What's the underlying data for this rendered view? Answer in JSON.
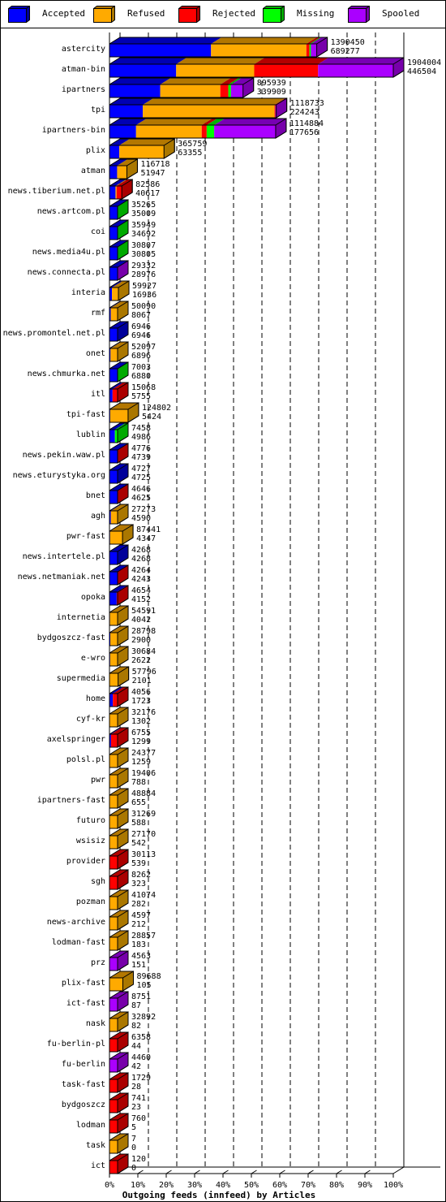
{
  "chart_data": {
    "type": "bar",
    "orientation": "horizontal",
    "stacked": true,
    "title": "Outgoing feeds (innfeed) by Articles",
    "xlabel": "Outgoing feeds (innfeed) by Articles",
    "ylabel": "",
    "xlim": [
      0,
      100
    ],
    "x_ticks": [
      "0%",
      "10%",
      "20%",
      "30%",
      "40%",
      "50%",
      "60%",
      "70%",
      "80%",
      "90%",
      "100%"
    ],
    "grid": true,
    "legend_position": "top",
    "legend": [
      {
        "name": "Accepted",
        "color": "#0000ff",
        "side": "#00009a"
      },
      {
        "name": "Refused",
        "color": "#ffaa00",
        "side": "#aa7700"
      },
      {
        "name": "Rejected",
        "color": "#ff0000",
        "side": "#aa0000"
      },
      {
        "name": "Missing",
        "color": "#00ff00",
        "side": "#00aa00"
      },
      {
        "name": "Spooled",
        "color": "#aa00ff",
        "side": "#7700aa"
      }
    ],
    "max_total": 1904004,
    "categories": [
      "astercity",
      "atman-bin",
      "ipartners",
      "tpi",
      "ipartners-bin",
      "plix",
      "atman",
      "news.tiberium.net.pl",
      "news.artcom.pl",
      "coi",
      "news.media4u.pl",
      "news.connecta.pl",
      "interia",
      "rmf",
      "news.promontel.net.pl",
      "onet",
      "news.chmurka.net",
      "itl",
      "tpi-fast",
      "lublin",
      "news.pekin.waw.pl",
      "news.eturystyka.org",
      "bnet",
      "agh",
      "pwr-fast",
      "news.intertele.pl",
      "news.netmaniak.net",
      "opoka",
      "internetia",
      "bydgoszcz-fast",
      "e-wro",
      "supermedia",
      "home",
      "cyf-kr",
      "axelspringer",
      "polsl.pl",
      "pwr",
      "ipartners-fast",
      "futuro",
      "wsisiz",
      "provider",
      "sgh",
      "pozman",
      "news-archive",
      "lodman-fast",
      "prz",
      "plix-fast",
      "ict-fast",
      "nask",
      "fu-berlin-pl",
      "fu-berlin",
      "task-fast",
      "bydgoszcz",
      "lodman",
      "task",
      "ict"
    ],
    "totals": [
      1390450,
      1904004,
      895939,
      1118733,
      1114884,
      365759,
      116718,
      82586,
      35265,
      35949,
      30807,
      29332,
      59927,
      50090,
      6946,
      52097,
      7003,
      15068,
      124802,
      7458,
      4776,
      4727,
      4646,
      27273,
      87441,
      4268,
      4264,
      4654,
      54591,
      28798,
      30684,
      57796,
      4056,
      32176,
      6755,
      24377,
      19406,
      48884,
      31269,
      27170,
      30113,
      8262,
      41074,
      4597,
      28857,
      4563,
      89688,
      8751,
      32892,
      6358,
      4460,
      1729,
      741,
      760,
      7,
      120
    ],
    "accepted": [
      689277,
      446504,
      339909,
      224243,
      177656,
      63355,
      51947,
      40617,
      35009,
      34692,
      30805,
      28976,
      16936,
      8067,
      6946,
      6896,
      6880,
      5755,
      5424,
      4986,
      4739,
      4725,
      4625,
      4590,
      4347,
      4268,
      4243,
      4152,
      4042,
      2900,
      2622,
      2101,
      1723,
      1302,
      1299,
      1259,
      788,
      655,
      588,
      542,
      539,
      323,
      282,
      212,
      183,
      151,
      105,
      87,
      82,
      44,
      42,
      28,
      23,
      5,
      0,
      0
    ],
    "segments": [
      [
        0.49,
        0.46,
        0.015,
        0.007,
        0.028
      ],
      [
        0.235,
        0.275,
        0.225,
        0.0,
        0.265
      ],
      [
        0.38,
        0.45,
        0.06,
        0.02,
        0.09
      ],
      [
        0.2,
        0.79,
        0.005,
        0.0,
        0.005
      ],
      [
        0.16,
        0.395,
        0.03,
        0.045,
        0.37
      ],
      [
        0.18,
        0.82,
        0.0,
        0.0,
        0.0
      ],
      [
        0.44,
        0.56,
        0.0,
        0.0,
        0.0
      ],
      [
        0.49,
        0.09,
        0.42,
        0.0,
        0.0
      ],
      [
        0.99,
        0.0,
        0.0,
        0.01,
        0.0
      ],
      [
        0.965,
        0.0,
        0.0,
        0.035,
        0.0
      ],
      [
        0.99,
        0.0,
        0.0,
        0.01,
        0.0
      ],
      [
        0.99,
        0.0,
        0.0,
        0.0,
        0.01
      ],
      [
        0.28,
        0.72,
        0.0,
        0.0,
        0.0
      ],
      [
        0.16,
        0.84,
        0.0,
        0.0,
        0.0
      ],
      [
        1.0,
        0.0,
        0.0,
        0.0,
        0.0
      ],
      [
        0.13,
        0.87,
        0.0,
        0.0,
        0.0
      ],
      [
        0.98,
        0.0,
        0.0,
        0.02,
        0.0
      ],
      [
        0.38,
        0.0,
        0.62,
        0.0,
        0.0
      ],
      [
        0.04,
        0.96,
        0.0,
        0.0,
        0.0
      ],
      [
        0.67,
        0.0,
        0.0,
        0.33,
        0.0
      ],
      [
        0.99,
        0.0,
        0.01,
        0.0,
        0.0
      ],
      [
        1.0,
        0.0,
        0.0,
        0.0,
        0.0
      ],
      [
        0.99,
        0.0,
        0.01,
        0.0,
        0.0
      ],
      [
        0.17,
        0.83,
        0.0,
        0.0,
        0.0
      ],
      [
        0.05,
        0.95,
        0.0,
        0.0,
        0.0
      ],
      [
        1.0,
        0.0,
        0.0,
        0.0,
        0.0
      ],
      [
        0.99,
        0.0,
        0.01,
        0.0,
        0.0
      ],
      [
        0.89,
        0.0,
        0.11,
        0.0,
        0.0
      ],
      [
        0.07,
        0.93,
        0.0,
        0.0,
        0.0
      ],
      [
        0.1,
        0.9,
        0.0,
        0.0,
        0.0
      ],
      [
        0.085,
        0.915,
        0.0,
        0.0,
        0.0
      ],
      [
        0.04,
        0.96,
        0.0,
        0.0,
        0.0
      ],
      [
        0.42,
        0.0,
        0.58,
        0.0,
        0.0
      ],
      [
        0.04,
        0.96,
        0.0,
        0.0,
        0.0
      ],
      [
        0.19,
        0.0,
        0.81,
        0.0,
        0.0
      ],
      [
        0.05,
        0.95,
        0.0,
        0.0,
        0.0
      ],
      [
        0.04,
        0.96,
        0.0,
        0.0,
        0.0
      ],
      [
        0.013,
        0.987,
        0.0,
        0.0,
        0.0
      ],
      [
        0.02,
        0.98,
        0.0,
        0.0,
        0.0
      ],
      [
        0.02,
        0.98,
        0.0,
        0.0,
        0.0
      ],
      [
        0.018,
        0.0,
        0.982,
        0.0,
        0.0
      ],
      [
        0.04,
        0.0,
        0.96,
        0.0,
        0.0
      ],
      [
        0.007,
        0.993,
        0.0,
        0.0,
        0.0
      ],
      [
        0.046,
        0.954,
        0.0,
        0.0,
        0.0
      ],
      [
        0.006,
        0.994,
        0.0,
        0.0,
        0.0
      ],
      [
        0.033,
        0.0,
        0.0,
        0.0,
        0.967
      ],
      [
        0.001,
        0.999,
        0.0,
        0.0,
        0.0
      ],
      [
        0.01,
        0.0,
        0.0,
        0.0,
        0.99
      ],
      [
        0.002,
        0.998,
        0.0,
        0.0,
        0.0
      ],
      [
        0.007,
        0.0,
        0.993,
        0.0,
        0.0
      ],
      [
        0.01,
        0.0,
        0.0,
        0.0,
        0.99
      ],
      [
        0.016,
        0.0,
        0.984,
        0.0,
        0.0
      ],
      [
        0.03,
        0.0,
        0.97,
        0.0,
        0.0
      ],
      [
        0.007,
        0.0,
        0.993,
        0.0,
        0.0
      ],
      [
        0.0,
        1.0,
        0.0,
        0.0,
        0.0
      ],
      [
        0.0,
        0.0,
        1.0,
        0.0,
        0.0
      ]
    ],
    "front_colors": [
      "mixed",
      "mixed",
      "mixed",
      "mixed",
      "mixed",
      "mixed",
      "mixed",
      "mixed",
      "#0000ff|#00aa00",
      "#0000ff|#00aa00",
      "#0000ff|#00aa00",
      "#0000ff|#7700aa",
      "#ffaa00|#7700aa",
      "#ffaa00|#7700aa",
      "#00009a",
      "#ffaa00|#00aa00",
      "#00aa00",
      "#aa0000",
      "#ffaa00|#7700aa",
      "#00aa00",
      "#aa0000",
      "#aa0000",
      "#aa0000",
      "#ffaa00|#aa0000",
      "#ffaa00|#7700aa",
      "#00009a",
      "#aa0000",
      "#aa0000",
      "#ffaa00|#7700aa",
      "#ffaa00|#7700aa",
      "#ffaa00|#aa7700",
      "#ffaa00|#7700aa",
      "#aa0000",
      "#ffaa00|#00aa00",
      "#aa0000",
      "#ffaa00|#aa0000",
      "#ffaa00|#7700aa",
      "#ffaa00|#7700aa",
      "#ffaa00|#aa0000",
      "#ffaa00|#aa0000",
      "#ff0000|#00aa00",
      "#aa0000",
      "#ffaa00|#7700aa",
      "#aa7700",
      "#ffaa00|#7700aa",
      "#7700aa",
      "#ffaa00|#aa7700",
      "#7700aa",
      "#ffaa00|#aa0000",
      "#aa0000",
      "#7700aa",
      "#aa0000",
      "#aa0000",
      "#aa0000",
      "#aa7700",
      "#aa0000"
    ]
  }
}
